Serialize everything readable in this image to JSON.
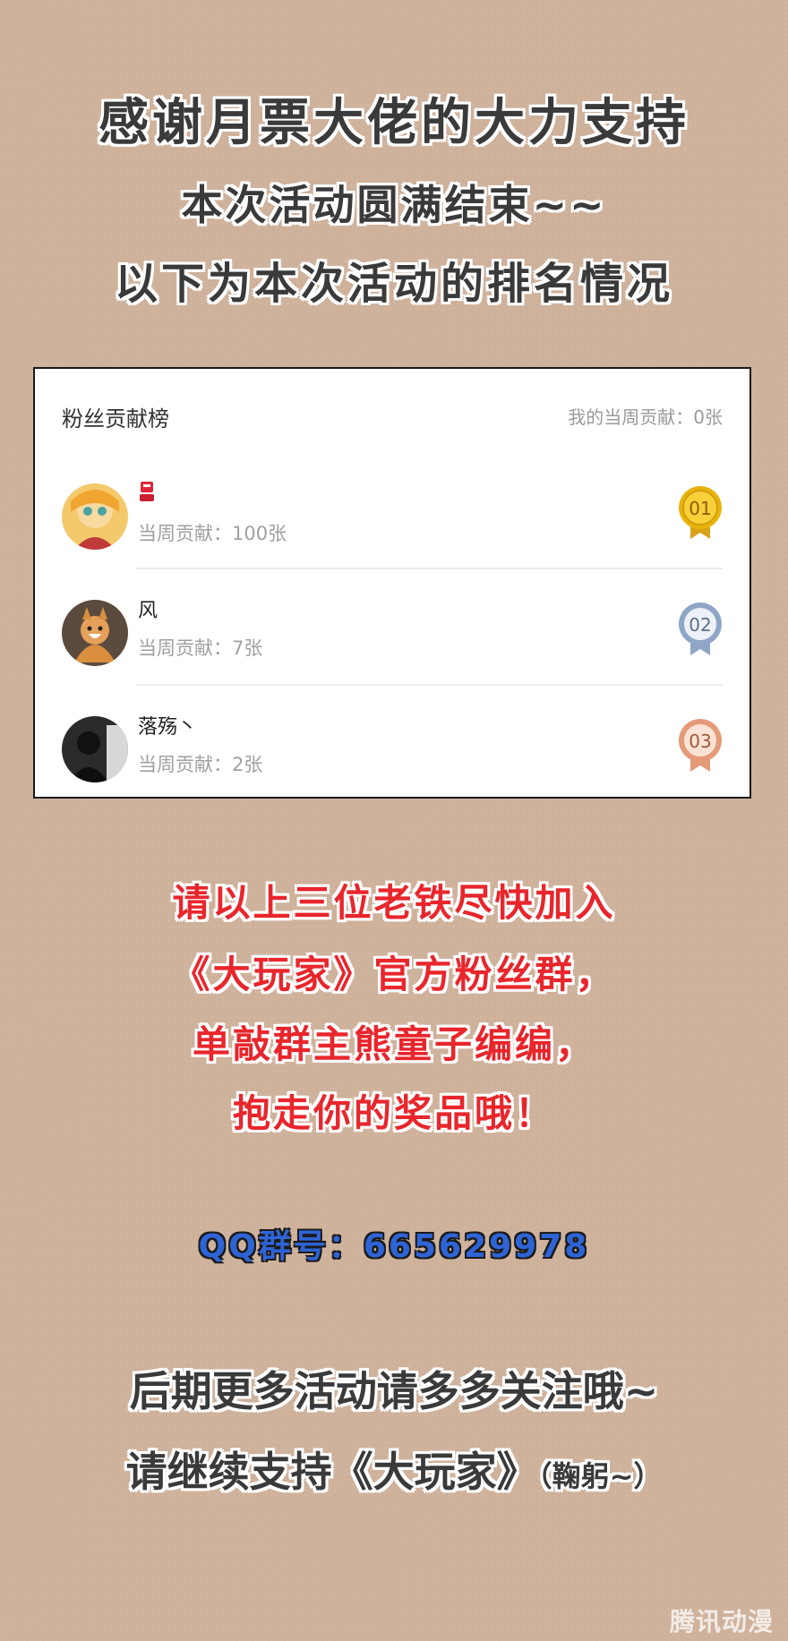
{
  "header": {
    "line1": "感谢月票大佬的大力支持",
    "line2": "本次活动圆满结束~~",
    "line3": "以下为本次活动的排名情况"
  },
  "leaderboard": {
    "title": "粉丝贡献榜",
    "my_contribution": "我的当周贡献：0张",
    "entries": [
      {
        "rank": "01",
        "name": "",
        "contribution": "当周贡献：100张",
        "medal_color": "#e8b40c"
      },
      {
        "rank": "02",
        "name": "风",
        "contribution": "当周贡献：7张",
        "medal_color": "#8fa6c6"
      },
      {
        "rank": "03",
        "name": "落殇丶",
        "contribution": "当周贡献：2张",
        "medal_color": "#e49a78"
      }
    ]
  },
  "notice": {
    "line1": "请以上三位老铁尽快加入",
    "line2": "《大玩家》官方粉丝群，",
    "line3": "单敲群主熊童子编编，",
    "line4": "抱走你的奖品哦！"
  },
  "qq_group": "QQ群号：665629978",
  "footer": {
    "line1": "后期更多活动请多多关注哦~",
    "line2_main": "请继续支持《大玩家》",
    "line2_paren": "（鞠躬~）"
  },
  "watermark": "腾讯动漫"
}
